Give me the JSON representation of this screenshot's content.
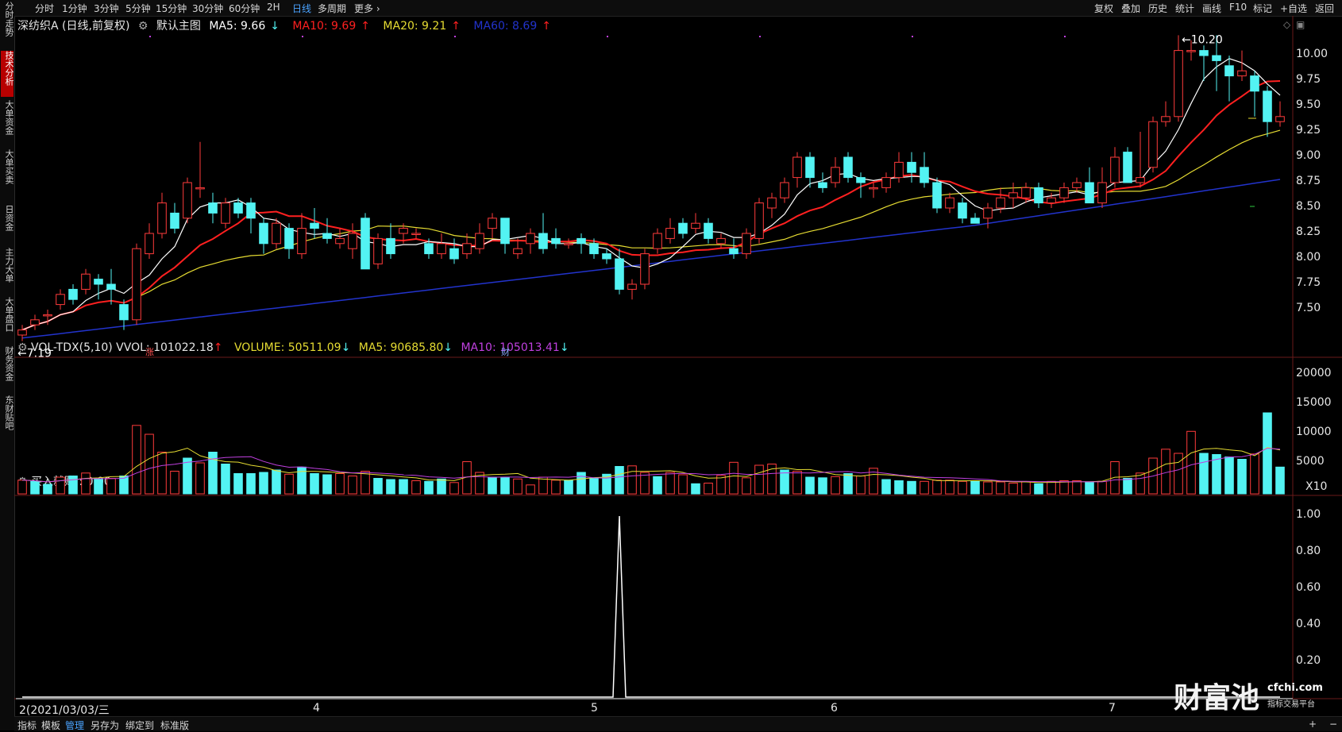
{
  "left_tabs": [
    "分时走势",
    "技术分析",
    "大单资金",
    "大单买卖",
    "日资金",
    "主力大单",
    "大单盘口",
    "财务资金",
    "东财贴吧"
  ],
  "period_tabs": [
    "分时",
    "1分钟",
    "3分钟",
    "5分钟",
    "15分钟",
    "30分钟",
    "60分钟",
    "2H",
    "日线",
    "多周期",
    "更多"
  ],
  "active_period": "日线",
  "right_buttons": [
    "复权",
    "叠加",
    "历史",
    "统计",
    "画线",
    "F10",
    "标记",
    "+自选",
    "返回"
  ],
  "header": {
    "stock": "深纺织A (日线,前复权)",
    "main_chart": "默认主图",
    "ma5": "MA5: 9.66",
    "ma10": "MA10: 9.69",
    "ma20": "MA20: 9.21",
    "ma60": "MA60: 8.69"
  },
  "volume_header": {
    "title": "VOL-TDX(5,10)",
    "vvol": "VVOL: 101022.18",
    "volume": "VOLUME: 50511.09",
    "ma5": "MA5: 90685.80",
    "ma10": "MA10: 105013.41"
  },
  "indicator_header": {
    "label": "买入就赚 : 0.00"
  },
  "price_axis": [
    "10.00",
    "9.75",
    "9.50",
    "9.25",
    "9.00",
    "8.75",
    "8.50",
    "8.25",
    "8.00",
    "7.75",
    "7.50"
  ],
  "volume_axis": [
    "20000",
    "15000",
    "10000",
    "5000",
    "X10"
  ],
  "indicator_axis": [
    "1.00",
    "0.80",
    "0.60",
    "0.40",
    "0.20"
  ],
  "x_axis": {
    "start": "2(2021/03/03/三",
    "months": [
      "4",
      "5",
      "6",
      "7"
    ]
  },
  "annotations": {
    "high": "10.20",
    "low": "7.19",
    "mark_up": "涨",
    "mark_fin": "财"
  },
  "bottom_tabs": [
    "指标",
    "模板",
    "管理",
    "另存为",
    "绑定到",
    "标准版"
  ],
  "active_bottom": "管理",
  "watermark": {
    "brand": "财富池",
    "site": "cfchi.com",
    "slogan": "指标交易平台"
  },
  "colors": {
    "up": "#ff3b3b",
    "down": "#53f3f3",
    "ma5": "#ffffff",
    "ma10": "#ff2020",
    "ma20": "#e6dc32",
    "ma60": "#2233cc",
    "vma10": "#c040e0",
    "active_tab": "#b80000",
    "link": "#4aa3ff"
  },
  "chart_data": {
    "type": "candlestick",
    "price_ylim": [
      7.19,
      10.2
    ],
    "volume_ylim": [
      0,
      20000
    ],
    "indicator_ylim": [
      0,
      1
    ],
    "indicator_spike_index": 47,
    "candles": [
      [
        7.25,
        7.3,
        7.19,
        7.35
      ],
      [
        7.35,
        7.4,
        7.3,
        7.45
      ],
      [
        7.45,
        7.45,
        7.35,
        7.5
      ],
      [
        7.55,
        7.65,
        7.5,
        7.7
      ],
      [
        7.7,
        7.6,
        7.55,
        7.75
      ],
      [
        7.7,
        7.85,
        7.65,
        7.9
      ],
      [
        7.8,
        7.75,
        7.6,
        7.85
      ],
      [
        7.75,
        7.7,
        7.55,
        7.9
      ],
      [
        7.55,
        7.4,
        7.3,
        7.6
      ],
      [
        7.4,
        8.1,
        7.35,
        8.15
      ],
      [
        8.05,
        8.25,
        8.0,
        8.35
      ],
      [
        8.25,
        8.55,
        8.2,
        8.65
      ],
      [
        8.45,
        8.3,
        8.25,
        8.55
      ],
      [
        8.4,
        8.75,
        8.35,
        8.8
      ],
      [
        8.7,
        8.7,
        8.6,
        9.15
      ],
      [
        8.55,
        8.45,
        8.35,
        8.65
      ],
      [
        8.35,
        8.55,
        8.3,
        8.6
      ],
      [
        8.55,
        8.45,
        8.4,
        8.6
      ],
      [
        8.55,
        8.4,
        8.25,
        8.6
      ],
      [
        8.35,
        8.15,
        8.05,
        8.4
      ],
      [
        8.15,
        8.35,
        8.1,
        8.4
      ],
      [
        8.3,
        8.1,
        8.0,
        8.35
      ],
      [
        8.05,
        8.3,
        8.0,
        8.45
      ],
      [
        8.35,
        8.3,
        8.2,
        8.5
      ],
      [
        8.25,
        8.2,
        8.15,
        8.4
      ],
      [
        8.15,
        8.2,
        8.1,
        8.3
      ],
      [
        8.1,
        8.25,
        8.0,
        8.35
      ],
      [
        8.4,
        7.9,
        7.9,
        8.45
      ],
      [
        7.95,
        8.2,
        7.9,
        8.25
      ],
      [
        8.2,
        8.05,
        8.0,
        8.35
      ],
      [
        8.25,
        8.3,
        8.15,
        8.35
      ],
      [
        8.25,
        8.25,
        8.2,
        8.3
      ],
      [
        8.15,
        8.05,
        8.0,
        8.2
      ],
      [
        8.05,
        8.15,
        8.0,
        8.25
      ],
      [
        8.1,
        8.0,
        7.95,
        8.2
      ],
      [
        8.05,
        8.15,
        8.0,
        8.25
      ],
      [
        8.1,
        8.25,
        8.05,
        8.35
      ],
      [
        8.3,
        8.4,
        8.2,
        8.45
      ],
      [
        8.4,
        8.15,
        8.05,
        8.4
      ],
      [
        8.05,
        8.1,
        8.0,
        8.2
      ],
      [
        8.15,
        8.25,
        8.05,
        8.3
      ],
      [
        8.25,
        8.1,
        8.05,
        8.45
      ],
      [
        8.2,
        8.15,
        8.1,
        8.3
      ],
      [
        8.15,
        8.15,
        8.1,
        8.2
      ],
      [
        8.2,
        8.15,
        8.05,
        8.25
      ],
      [
        8.15,
        8.05,
        8.0,
        8.2
      ],
      [
        8.05,
        8.0,
        7.95,
        8.1
      ],
      [
        8.0,
        7.7,
        7.65,
        8.1
      ],
      [
        7.7,
        7.75,
        7.6,
        7.8
      ],
      [
        7.75,
        8.05,
        7.7,
        8.1
      ],
      [
        8.1,
        8.25,
        8.05,
        8.3
      ],
      [
        8.2,
        8.3,
        8.15,
        8.4
      ],
      [
        8.35,
        8.25,
        8.2,
        8.4
      ],
      [
        8.3,
        8.35,
        8.25,
        8.45
      ],
      [
        8.35,
        8.2,
        8.15,
        8.4
      ],
      [
        8.15,
        8.2,
        8.1,
        8.25
      ],
      [
        8.1,
        8.05,
        8.0,
        8.2
      ],
      [
        8.05,
        8.25,
        8.0,
        8.3
      ],
      [
        8.2,
        8.55,
        8.15,
        8.6
      ],
      [
        8.5,
        8.6,
        8.4,
        8.65
      ],
      [
        8.6,
        8.75,
        8.55,
        8.8
      ],
      [
        8.8,
        9.0,
        8.7,
        9.05
      ],
      [
        9.0,
        8.8,
        8.7,
        9.05
      ],
      [
        8.75,
        8.7,
        8.65,
        8.85
      ],
      [
        8.75,
        8.9,
        8.7,
        9.0
      ],
      [
        9.0,
        8.8,
        8.75,
        9.05
      ],
      [
        8.8,
        8.75,
        8.6,
        8.85
      ],
      [
        8.7,
        8.7,
        8.6,
        8.75
      ],
      [
        8.7,
        8.8,
        8.65,
        8.85
      ],
      [
        8.8,
        8.95,
        8.75,
        9.05
      ],
      [
        8.95,
        8.85,
        8.75,
        9.05
      ],
      [
        8.9,
        8.75,
        8.7,
        9.05
      ],
      [
        8.75,
        8.5,
        8.45,
        8.8
      ],
      [
        8.5,
        8.6,
        8.45,
        8.65
      ],
      [
        8.55,
        8.4,
        8.35,
        8.6
      ],
      [
        8.4,
        8.35,
        8.35,
        8.45
      ],
      [
        8.4,
        8.5,
        8.3,
        8.55
      ],
      [
        8.5,
        8.6,
        8.45,
        8.7
      ],
      [
        8.6,
        8.65,
        8.5,
        8.75
      ],
      [
        8.6,
        8.7,
        8.55,
        8.75
      ],
      [
        8.7,
        8.55,
        8.5,
        8.75
      ],
      [
        8.55,
        8.6,
        8.5,
        8.65
      ],
      [
        8.6,
        8.7,
        8.55,
        8.75
      ],
      [
        8.7,
        8.75,
        8.65,
        8.8
      ],
      [
        8.75,
        8.55,
        8.55,
        8.9
      ],
      [
        8.55,
        8.75,
        8.5,
        8.9
      ],
      [
        8.75,
        9.0,
        8.7,
        9.1
      ],
      [
        9.05,
        8.75,
        8.75,
        9.1
      ],
      [
        8.75,
        8.8,
        8.7,
        9.25
      ],
      [
        8.9,
        9.35,
        8.85,
        9.4
      ],
      [
        9.35,
        9.4,
        9.3,
        9.55
      ],
      [
        9.4,
        10.05,
        9.35,
        10.2
      ],
      [
        10.05,
        10.05,
        9.95,
        10.15
      ],
      [
        10.05,
        10.0,
        9.75,
        10.1
      ],
      [
        10.0,
        9.95,
        9.65,
        10.2
      ],
      [
        9.9,
        9.8,
        9.55,
        10.0
      ],
      [
        9.8,
        9.85,
        9.75,
        10.05
      ],
      [
        9.8,
        9.65,
        9.4,
        9.85
      ],
      [
        9.65,
        9.35,
        9.2,
        9.7
      ],
      [
        9.35,
        9.4,
        9.3,
        9.55
      ]
    ],
    "volumes": [
      [
        2300,
        1
      ],
      [
        2100,
        0
      ],
      [
        1600,
        0
      ],
      [
        2800,
        1
      ],
      [
        3000,
        0
      ],
      [
        3500,
        1
      ],
      [
        2500,
        0
      ],
      [
        2600,
        1
      ],
      [
        3000,
        0
      ],
      [
        11500,
        1
      ],
      [
        10000,
        1
      ],
      [
        7000,
        1
      ],
      [
        3800,
        1
      ],
      [
        6000,
        0
      ],
      [
        5200,
        1
      ],
      [
        7000,
        0
      ],
      [
        5000,
        0
      ],
      [
        3400,
        0
      ],
      [
        3400,
        0
      ],
      [
        3600,
        0
      ],
      [
        4000,
        0
      ],
      [
        3300,
        1
      ],
      [
        4500,
        0
      ],
      [
        3400,
        0
      ],
      [
        3200,
        0
      ],
      [
        3400,
        1
      ],
      [
        3000,
        1
      ],
      [
        3800,
        1
      ],
      [
        2600,
        0
      ],
      [
        2400,
        0
      ],
      [
        2400,
        0
      ],
      [
        2200,
        1
      ],
      [
        2100,
        0
      ],
      [
        2500,
        0
      ],
      [
        1900,
        1
      ],
      [
        5400,
        1
      ],
      [
        3600,
        1
      ],
      [
        2800,
        0
      ],
      [
        2800,
        0
      ],
      [
        2500,
        1
      ],
      [
        1500,
        1
      ],
      [
        2800,
        1
      ],
      [
        2300,
        1
      ],
      [
        2300,
        0
      ],
      [
        3600,
        0
      ],
      [
        2600,
        0
      ],
      [
        3300,
        0
      ],
      [
        4600,
        0
      ],
      [
        4700,
        1
      ],
      [
        3600,
        1
      ],
      [
        2900,
        0
      ],
      [
        3600,
        1
      ],
      [
        3200,
        1
      ],
      [
        1700,
        0
      ],
      [
        1800,
        1
      ],
      [
        3100,
        1
      ],
      [
        5300,
        1
      ],
      [
        2700,
        1
      ],
      [
        4800,
        1
      ],
      [
        5000,
        1
      ],
      [
        4000,
        0
      ],
      [
        3800,
        1
      ],
      [
        2800,
        0
      ],
      [
        2700,
        0
      ],
      [
        2900,
        1
      ],
      [
        3400,
        0
      ],
      [
        3000,
        1
      ],
      [
        4300,
        1
      ],
      [
        2400,
        0
      ],
      [
        2200,
        0
      ],
      [
        2100,
        0
      ],
      [
        2100,
        1
      ],
      [
        2300,
        1
      ],
      [
        2300,
        1
      ],
      [
        2100,
        1
      ],
      [
        2200,
        0
      ],
      [
        2000,
        1
      ],
      [
        2000,
        1
      ],
      [
        1800,
        1
      ],
      [
        2000,
        1
      ],
      [
        1700,
        0
      ],
      [
        2100,
        1
      ],
      [
        2200,
        1
      ],
      [
        2200,
        1
      ],
      [
        2000,
        0
      ],
      [
        2100,
        1
      ],
      [
        5400,
        1
      ],
      [
        2600,
        0
      ],
      [
        3500,
        1
      ],
      [
        6000,
        1
      ],
      [
        7500,
        1
      ],
      [
        6800,
        1
      ],
      [
        10500,
        1
      ],
      [
        6800,
        0
      ],
      [
        6600,
        0
      ],
      [
        6200,
        0
      ],
      [
        5800,
        0
      ],
      [
        6700,
        1
      ],
      [
        13600,
        0
      ],
      [
        4500,
        0
      ]
    ]
  }
}
